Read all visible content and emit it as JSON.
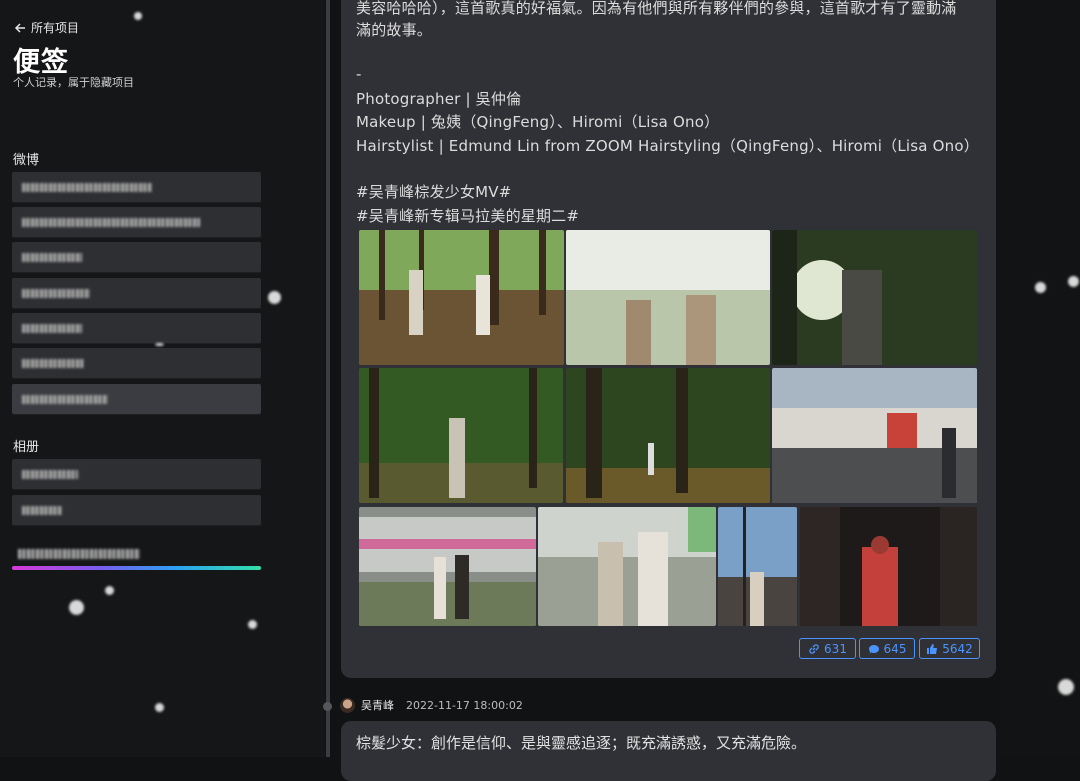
{
  "sidebar": {
    "back_label": "所有项目",
    "title": "便签",
    "subtitle": "个人记录，属于隐藏项目",
    "sections": [
      {
        "label": "微博"
      },
      {
        "label": "相册"
      }
    ],
    "progress": 1.0
  },
  "post": {
    "lines": [
      "美容哈哈哈），這首歌真的好福氣。因為有他們與所有夥伴們的參與，這首歌才有了靈動滿",
      "滿的故事。",
      "-",
      "Photographer | 吳仲倫",
      "Makeup | 兔姨（QingFeng）、Hiromi（Lisa Ono）",
      "Hairstylist | Edmund Lin from ZOOM Hairstyling（QingFeng）、Hiromi（Lisa Ono）",
      "#吴青峰棕发少女MV#",
      "#吴青峰新专辑马拉美的星期二#"
    ],
    "stats": {
      "reposts": "631",
      "comments": "645",
      "likes": "5642"
    }
  },
  "next_post": {
    "author": "吴青峰",
    "date": "2022-11-17 18:00:02",
    "text": "棕髮少女：創作是信仰、是與靈感追逐；既充滿誘惑，又充滿危險。"
  },
  "colors": {
    "accent": "#4b93ff",
    "card": "#2f3136",
    "sidebar_item": "#2d2f33"
  }
}
